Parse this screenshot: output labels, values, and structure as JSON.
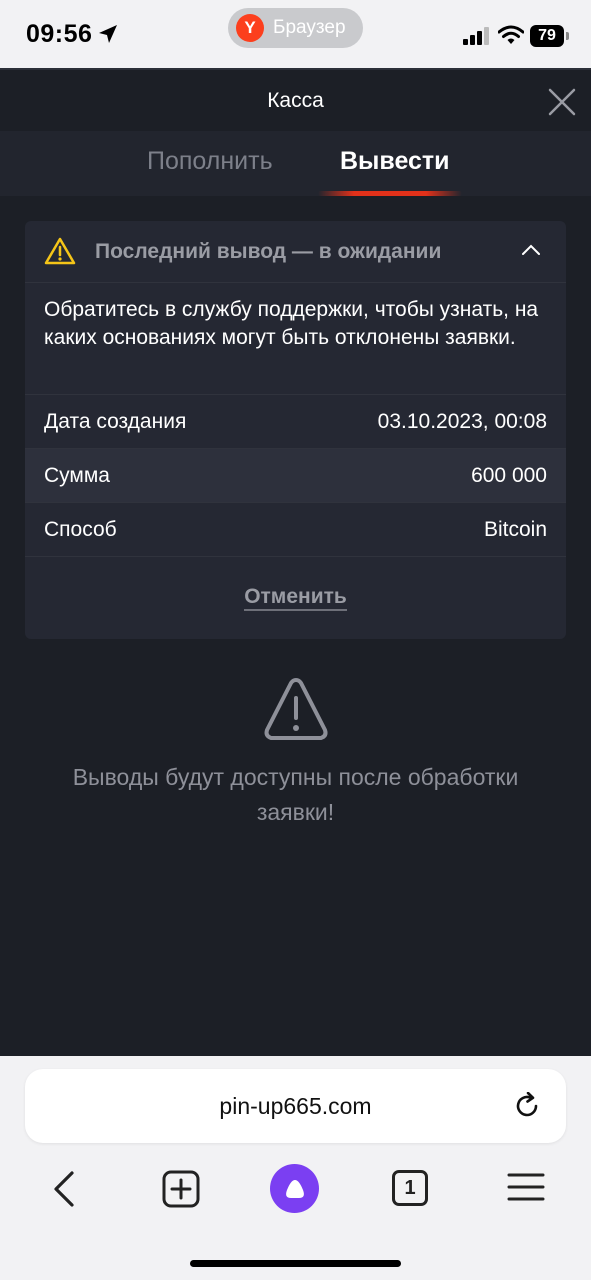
{
  "status_bar": {
    "time": "09:56",
    "browser_label": "Браузер",
    "browser_logo": "Y",
    "battery": "79"
  },
  "header": {
    "title": "Касса"
  },
  "tabs": {
    "deposit": "Пополнить",
    "withdraw": "Вывести",
    "active": "withdraw"
  },
  "withdrawal_card": {
    "title": "Последний вывод — в ожидании",
    "message": "Обратитесь в службу поддержки, чтобы узнать, на каких основаниях могут быть отклонены заявки.",
    "rows": [
      {
        "label": "Дата создания",
        "value": "03.10.2023, 00:08"
      },
      {
        "label": "Сумма",
        "value": "600 000"
      },
      {
        "label": "Способ",
        "value": "Bitcoin"
      }
    ],
    "cancel_label": "Отменить"
  },
  "notice": {
    "text": "Выводы будут доступны после обработки заявки!"
  },
  "browser": {
    "url": "pin-up665.com",
    "tab_count": "1"
  },
  "colors": {
    "background": "#1c1f26",
    "card": "#252833",
    "accent_underline": "#e2311a",
    "warning": "#f5c518",
    "alice": "#7b3ff2"
  }
}
